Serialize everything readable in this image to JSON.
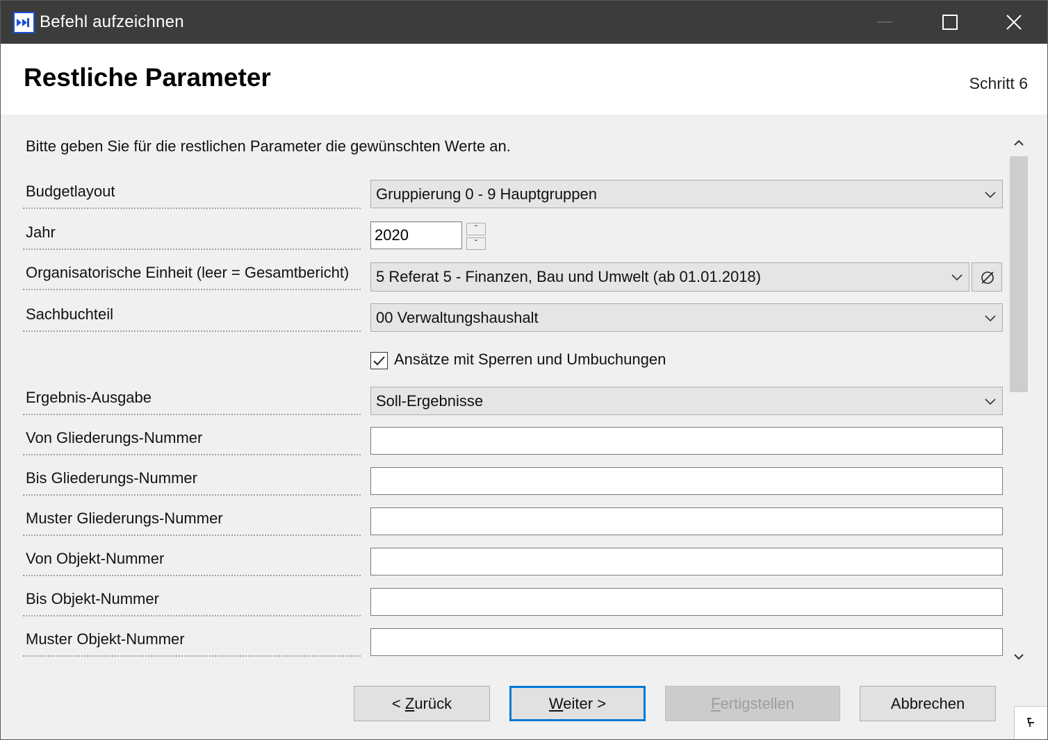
{
  "window": {
    "title": "Befehl aufzeichnen"
  },
  "header": {
    "title": "Restliche Parameter",
    "step": "Schritt 6"
  },
  "intro": "Bitte geben Sie für die restlichen Parameter die gewünschten Werte an.",
  "fields": {
    "budgetlayout": {
      "label": "Budgetlayout",
      "value": "Gruppierung 0 - 9 Hauptgruppen"
    },
    "jahr": {
      "label": "Jahr",
      "value": "2020"
    },
    "org_einheit": {
      "label": "Organisatorische Einheit (leer = Gesamtbericht)",
      "value": "5 Referat 5 - Finanzen, Bau und Umwelt (ab 01.01.2018)"
    },
    "sachbuchteil": {
      "label": "Sachbuchteil",
      "value": "00 Verwaltungshaushalt"
    },
    "ansaetze_checkbox": {
      "label": "Ansätze mit Sperren und Umbuchungen",
      "checked": true
    },
    "ergebnis_ausgabe": {
      "label": "Ergebnis-Ausgabe",
      "value": "Soll-Ergebnisse"
    },
    "von_gliederung": {
      "label": "Von Gliederungs-Nummer",
      "value": ""
    },
    "bis_gliederung": {
      "label": "Bis Gliederungs-Nummer",
      "value": ""
    },
    "muster_gliederung": {
      "label": "Muster Gliederungs-Nummer",
      "value": ""
    },
    "von_objekt": {
      "label": "Von Objekt-Nummer",
      "value": ""
    },
    "bis_objekt": {
      "label": "Bis Objekt-Nummer",
      "value": ""
    },
    "muster_objekt": {
      "label": "Muster Objekt-Nummer",
      "value": ""
    }
  },
  "buttons": {
    "back_prefix": "< ",
    "back_key": "Z",
    "back_rest": "urück",
    "next_key": "W",
    "next_rest": "eiter >",
    "finish_key": "F",
    "finish_rest": "ertigstellen",
    "cancel": "Abbrechen"
  },
  "icons": {
    "app": "double-arrow-icon",
    "clear": "empty-set-icon",
    "dropdown": "chevron-down-icon"
  },
  "colors": {
    "titlebar": "#3c3c3c",
    "focus_border": "#0078d7",
    "content_bg": "#f0f0f0"
  }
}
